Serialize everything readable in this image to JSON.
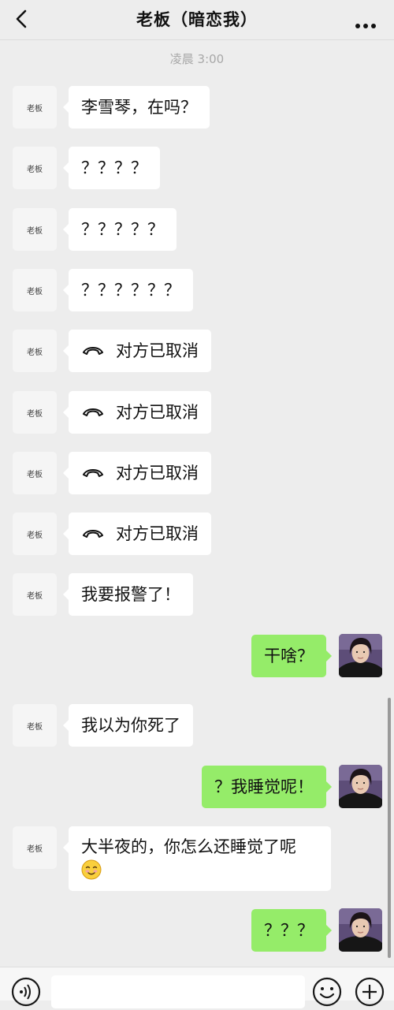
{
  "header": {
    "title": "老板（暗恋我）",
    "back_icon": "chevron-left-icon",
    "more_icon": "more-dots-icon"
  },
  "timestamp": "凌晨 3:00",
  "contact_avatar_label": "老板",
  "messages": [
    {
      "side": "left",
      "type": "text",
      "text": "李雪琴，在吗？"
    },
    {
      "side": "left",
      "type": "text",
      "text": "？？？？"
    },
    {
      "side": "left",
      "type": "text",
      "text": "？？？？？"
    },
    {
      "side": "left",
      "type": "text",
      "text": "？？？？？？"
    },
    {
      "side": "left",
      "type": "call",
      "icon": "phone-hangup-icon",
      "text": "对方已取消"
    },
    {
      "side": "left",
      "type": "call",
      "icon": "phone-hangup-icon",
      "text": "对方已取消"
    },
    {
      "side": "left",
      "type": "call",
      "icon": "phone-hangup-icon",
      "text": "对方已取消"
    },
    {
      "side": "left",
      "type": "call",
      "icon": "phone-hangup-icon",
      "text": "对方已取消"
    },
    {
      "side": "left",
      "type": "text",
      "text": "我要报警了！"
    },
    {
      "side": "right",
      "type": "text",
      "text": "干啥？"
    },
    {
      "side": "left",
      "type": "text",
      "text": "我以为你死了"
    },
    {
      "side": "right",
      "type": "text",
      "text": "？我睡觉呢！"
    },
    {
      "side": "left",
      "type": "text",
      "text": "大半夜的，你怎么还睡觉了呢",
      "emoji": "smile-emoji-icon"
    },
    {
      "side": "right",
      "type": "text",
      "text": "？？？"
    }
  ],
  "input_bar": {
    "voice_icon": "voice-icon",
    "emoji_icon": "emoji-icon",
    "plus_icon": "plus-icon",
    "input_value": ""
  },
  "colors": {
    "background": "#ededed",
    "bubble_left": "#ffffff",
    "bubble_right": "#95ec69",
    "timestamp": "#a8a8a8"
  }
}
